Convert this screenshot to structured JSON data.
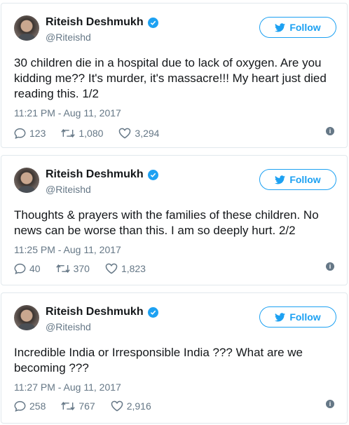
{
  "colors": {
    "accent": "#1da1f2",
    "text": "#14171a",
    "muted": "#657786",
    "border": "#e1e8ed"
  },
  "follow_label": "Follow",
  "tweets": [
    {
      "name": "Riteish Deshmukh",
      "handle": "@Riteishd",
      "text": "30 children die in a hospital due to lack of oxygen. Are you kidding me?? It's murder, it's massacre!!! My heart just died reading this. 1/2",
      "time": "11:21 PM - Aug 11, 2017",
      "replies": "123",
      "retweets": "1,080",
      "likes": "3,294"
    },
    {
      "name": "Riteish Deshmukh",
      "handle": "@Riteishd",
      "text": "Thoughts & prayers with the families of these children. No news can be worse than this. I am so deeply hurt. 2/2",
      "time": "11:25 PM - Aug 11, 2017",
      "replies": "40",
      "retweets": "370",
      "likes": "1,823"
    },
    {
      "name": "Riteish Deshmukh",
      "handle": "@Riteishd",
      "text": "Incredible India or Irresponsible India ??? What are we becoming ???",
      "time": "11:27 PM - Aug 11, 2017",
      "replies": "258",
      "retweets": "767",
      "likes": "2,916"
    }
  ]
}
